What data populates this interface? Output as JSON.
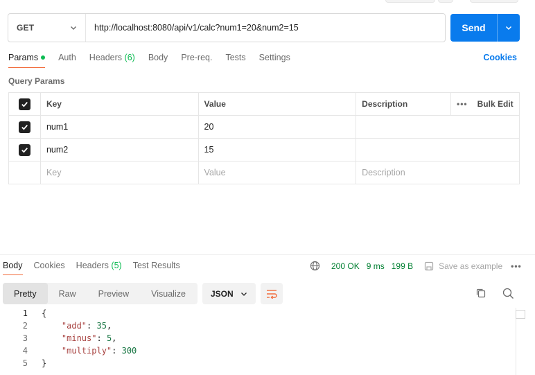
{
  "request": {
    "method": "GET",
    "url": "http://localhost:8080/api/v1/calc?num1=20&num2=15",
    "send_label": "Send"
  },
  "request_tabs": [
    {
      "label": "Params",
      "active": true
    },
    {
      "label": "Auth"
    },
    {
      "label": "Headers",
      "count": "(6)"
    },
    {
      "label": "Body"
    },
    {
      "label": "Pre-req."
    },
    {
      "label": "Tests"
    },
    {
      "label": "Settings"
    }
  ],
  "cookies_label": "Cookies",
  "query_params": {
    "title": "Query Params",
    "headers": {
      "key": "Key",
      "value": "Value",
      "description": "Description",
      "bulk_edit": "Bulk Edit"
    },
    "rows": [
      {
        "key": "num1",
        "value": "20",
        "description": ""
      },
      {
        "key": "num2",
        "value": "15",
        "description": ""
      }
    ],
    "placeholder": {
      "key": "Key",
      "value": "Value",
      "description": "Description"
    }
  },
  "response_tabs": [
    {
      "label": "Body",
      "active": true
    },
    {
      "label": "Cookies"
    },
    {
      "label": "Headers",
      "count": "(5)"
    },
    {
      "label": "Test Results"
    }
  ],
  "response_status": {
    "status": "200 OK",
    "time": "9 ms",
    "size": "199 B",
    "save_label": "Save as example"
  },
  "view_modes": [
    "Pretty",
    "Raw",
    "Preview",
    "Visualize"
  ],
  "format": "JSON",
  "response_body": {
    "line_numbers": [
      "1",
      "2",
      "3",
      "4",
      "5"
    ],
    "open_brace": "{",
    "close_brace": "}",
    "entries": [
      {
        "key": "\"add\"",
        "value": "35",
        "sep": ","
      },
      {
        "key": "\"minus\"",
        "value": "5",
        "sep": ","
      },
      {
        "key": "\"multiply\"",
        "value": "300",
        "sep": ""
      }
    ]
  },
  "colors": {
    "accent": "#097bed",
    "tab_underline": "#f26b3a",
    "status_green": "#007f31"
  }
}
